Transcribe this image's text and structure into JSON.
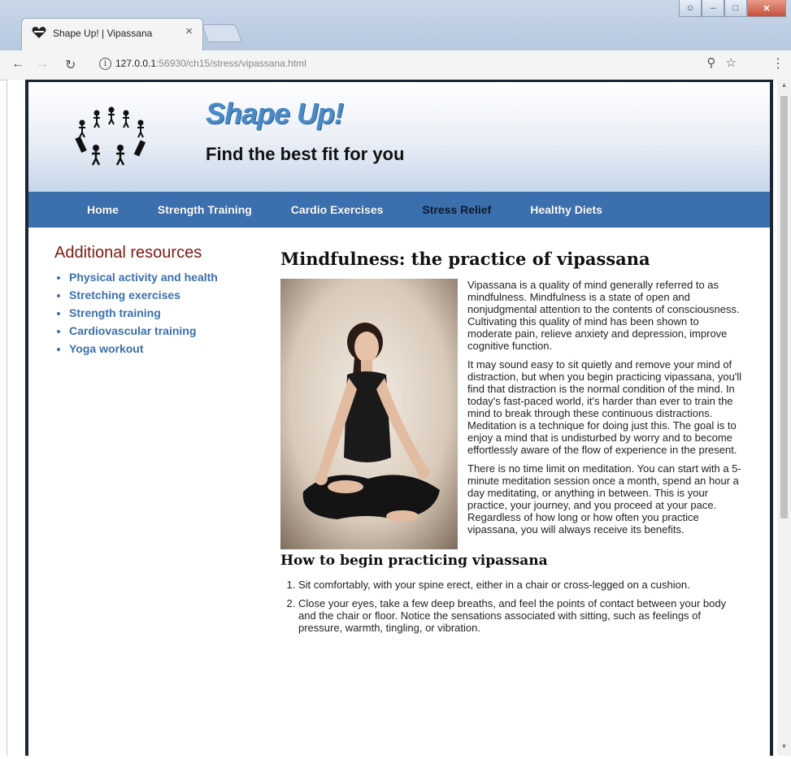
{
  "browser": {
    "tab_title": "Shape Up! | Vipassana",
    "close_glyph": "×",
    "url_host": "127.0.0.1",
    "url_path": ":56930/ch15/stress/vipassana.html"
  },
  "site": {
    "title": "Shape Up!",
    "tagline": "Find the best fit for you"
  },
  "nav": {
    "items": [
      {
        "label": "Home"
      },
      {
        "label": "Strength Training"
      },
      {
        "label": "Cardio Exercises"
      },
      {
        "label": "Stress Relief"
      },
      {
        "label": "Healthy Diets"
      }
    ],
    "active": "Stress Relief"
  },
  "sidebar": {
    "heading": "Additional resources",
    "links": [
      {
        "label": "Physical activity and health"
      },
      {
        "label": "Stretching exercises"
      },
      {
        "label": "Strength training"
      },
      {
        "label": "Cardiovascular training"
      },
      {
        "label": "Yoga workout"
      }
    ]
  },
  "article": {
    "title": "Mindfulness: the practice of vipassana",
    "paragraphs": [
      "Vipassana is a quality of mind generally referred to as mindfulness. Mindfulness is a state of open and nonjudgmental attention to the contents of consciousness. Cultivating this quality of mind has been shown to moderate pain, relieve anxiety and depression, improve cognitive function.",
      "It may sound easy to sit quietly and remove your mind of distraction, but when you begin practicing vipassana, you'll find that distraction is the normal condition of the mind. In today's fast-paced world, it's harder than ever to train the mind to break through these continuous distractions. Meditation is a technique for doing just this. The goal is to enjoy a mind that is undisturbed by worry and to become effortlessly aware of the flow of experience in the present.",
      "There is no time limit on meditation. You can start with a 5-minute meditation session once a month, spend an hour a day meditating, or anything in between. This is your practice, your journey, and you proceed at your pace. Regardless of how long or how often you practice vipassana, you will always receive its benefits."
    ],
    "subheading": "How to begin practicing vipassana",
    "steps": [
      "Sit comfortably, with your spine erect, either in a chair or cross-legged on a cushion.",
      "Close your eyes, take a few deep breaths, and feel the points of contact between your body and the chair or floor. Notice the sensations associated with sitting, such as feelings of pressure, warmth, tingling, or vibration."
    ]
  }
}
